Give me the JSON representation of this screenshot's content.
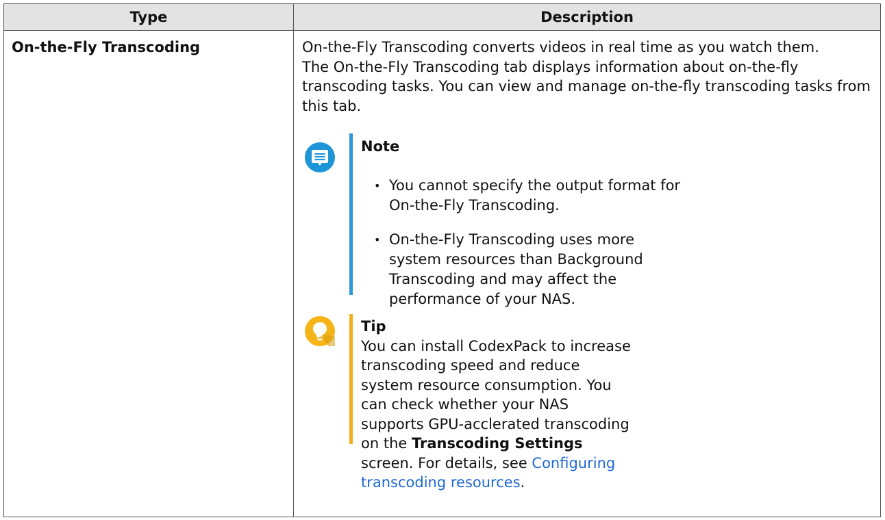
{
  "table": {
    "headers": [
      "Type",
      "Description"
    ],
    "row": {
      "type": "On-the-Fly Transcoding",
      "paragraphs": [
        "On-the-Fly Transcoding converts videos in real time as you watch them.",
        "The On-the-Fly Transcoding tab displays information about on-the-fly transcoding tasks. You can view and manage on-the-fly transcoding tasks from this tab."
      ],
      "note": {
        "title": "Note",
        "icon": "note-icon",
        "items": [
          "You cannot specify the output format for On-the-Fly Transcoding.",
          "On-the-Fly Transcoding uses more system resources than Background Transcoding and may affect the performance of your NAS."
        ]
      },
      "tip": {
        "title": "Tip",
        "icon": "lightbulb-icon",
        "text1": "You can install CodexPack to increase transcoding speed and reduce system resource consumption. You can check whether your NAS supports GPU-acclerated transcoding on the ",
        "bold": "Transcoding Settings",
        "text2": " screen. For details, see ",
        "link": "Configuring transcoding resources",
        "end": "."
      }
    }
  },
  "colors": {
    "note_accent": "#1e95d6",
    "tip_accent": "#f5b518",
    "link": "#1d67d4",
    "header_bg": "#e3e3e3"
  }
}
